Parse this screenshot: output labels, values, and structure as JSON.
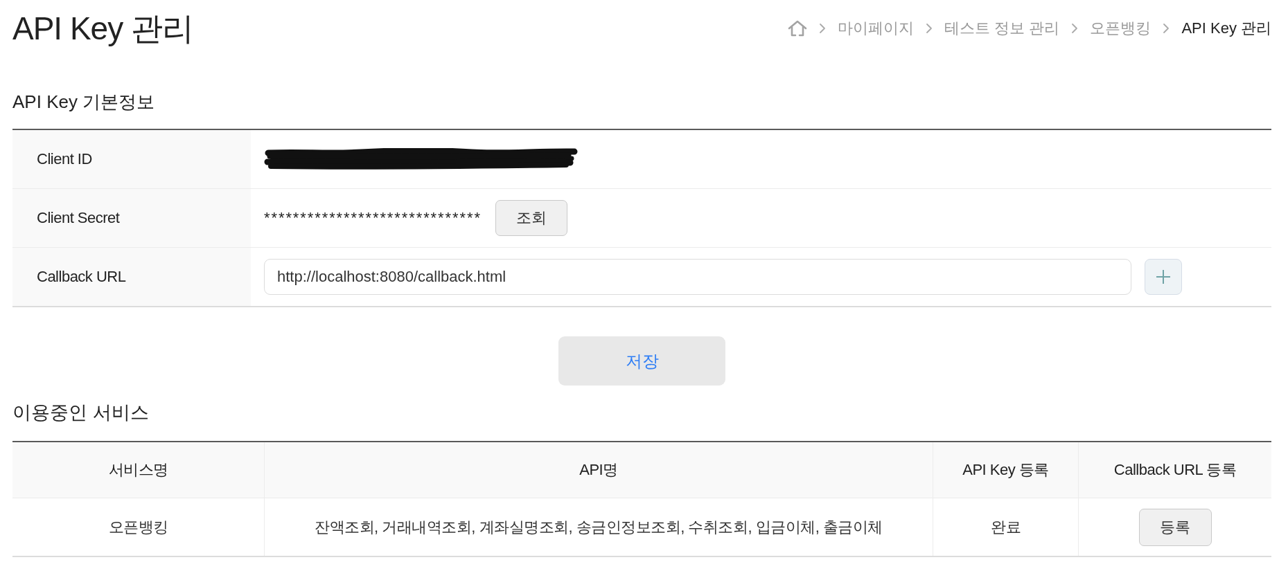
{
  "page": {
    "title": "API Key 관리"
  },
  "breadcrumb": [
    {
      "label": "마이페이지",
      "current": false
    },
    {
      "label": "테스트 정보 관리",
      "current": false
    },
    {
      "label": "오픈뱅킹",
      "current": false
    },
    {
      "label": "API Key 관리",
      "current": true
    }
  ],
  "key_info": {
    "heading": "API Key 기본정보",
    "rows": [
      {
        "kind": "redacted",
        "label": "Client ID"
      },
      {
        "kind": "masked",
        "label": "Client Secret",
        "value": "******************************",
        "button": "조회"
      },
      {
        "kind": "input",
        "label": "Callback URL",
        "value": "http://localhost:8080/callback.html"
      }
    ],
    "save_button": "저장"
  },
  "services": {
    "heading": "이용중인 서비스",
    "columns": [
      "서비스명",
      "API명",
      "API Key 등록",
      "Callback URL 등록"
    ],
    "rows": [
      {
        "service_name": "오픈뱅킹",
        "api_names": "잔액조회, 거래내역조회, 계좌실명조회, 송금인정보조회, 수취조회, 입금이체, 출금이체",
        "api_key_status": "완료",
        "callback_url_action": "등록"
      }
    ]
  }
}
